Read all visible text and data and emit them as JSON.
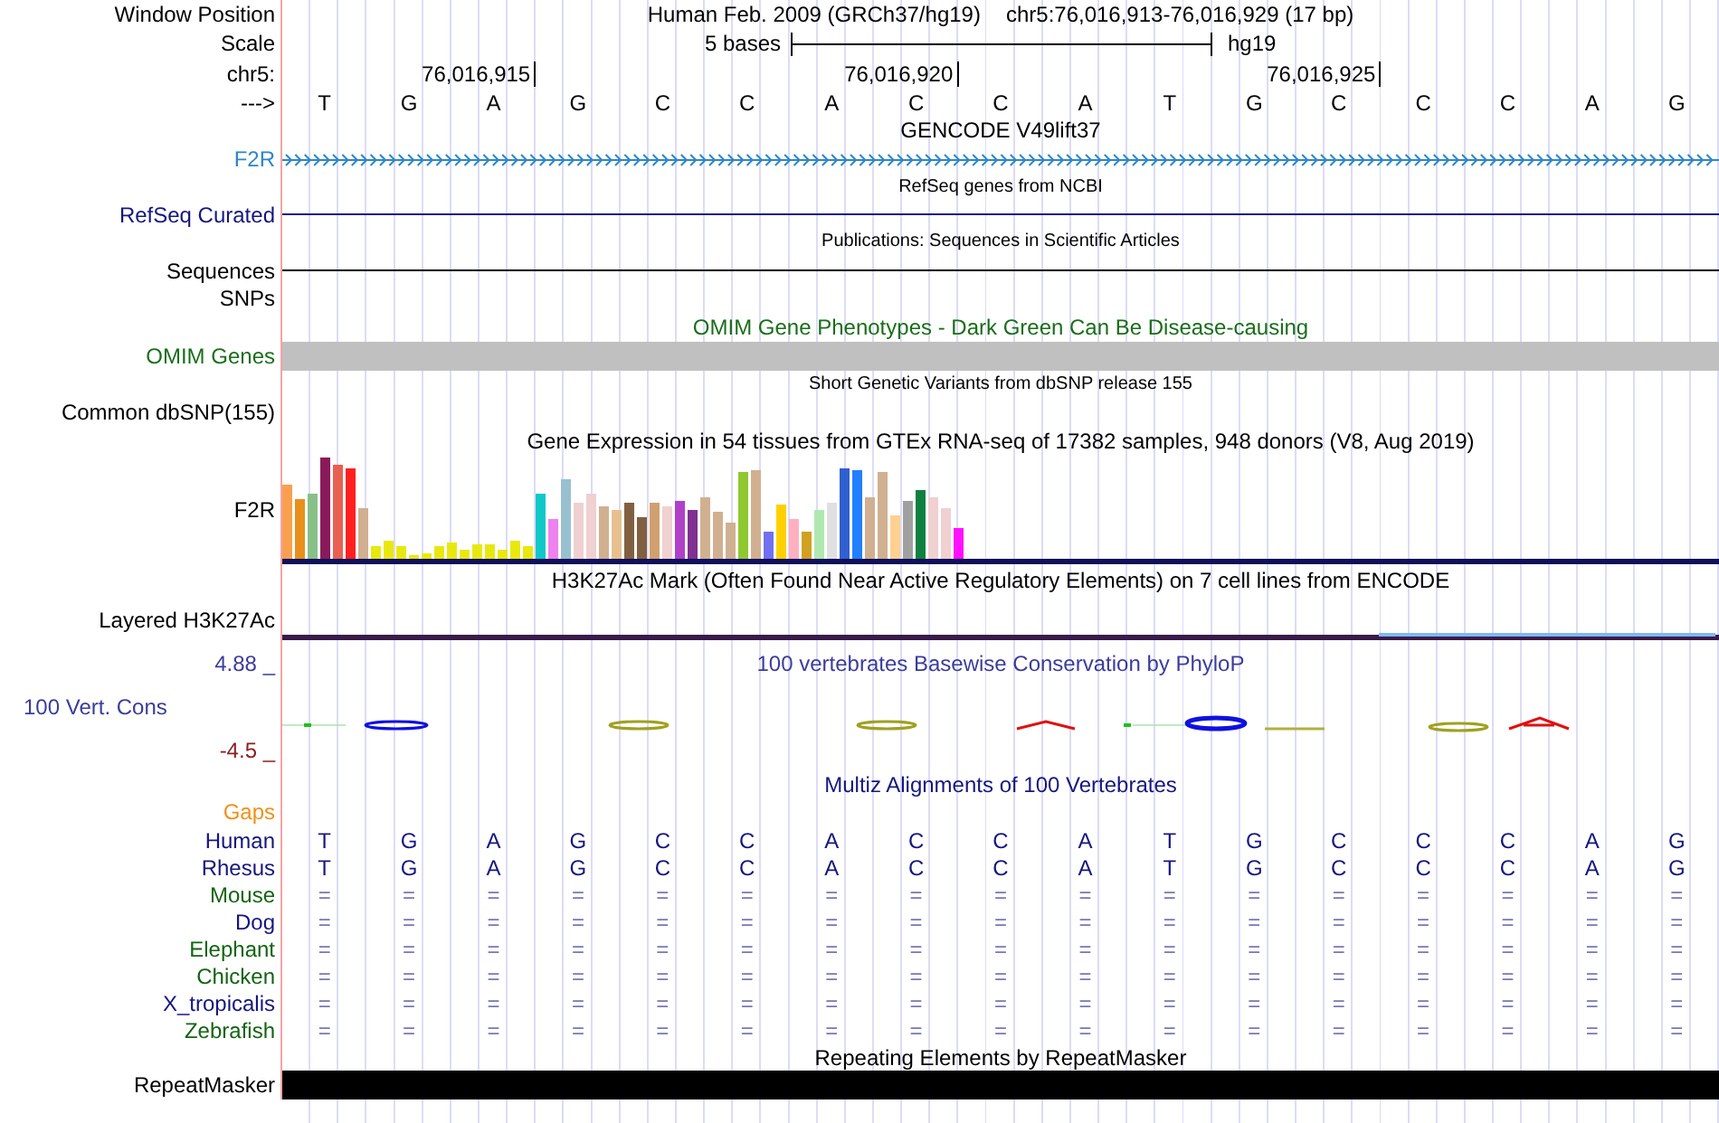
{
  "window_position": {
    "label": "Window Position",
    "assembly": "Human Feb. 2009 (GRCh37/hg19)",
    "region": "chr5:76,016,913-76,016,929 (17 bp)"
  },
  "scale": {
    "label": "Scale",
    "span": "5 bases",
    "assembly": "hg19"
  },
  "ruler": {
    "label": "chr5:",
    "ticks": [
      "76,016,915",
      "76,016,920",
      "76,016,925"
    ]
  },
  "sequence": {
    "label": "--->",
    "bases": [
      "T",
      "G",
      "A",
      "G",
      "C",
      "C",
      "A",
      "C",
      "C",
      "A",
      "T",
      "G",
      "C",
      "C",
      "C",
      "A",
      "G"
    ]
  },
  "tracks": [
    {
      "title": {
        "text": "GENCODE V49lift37",
        "kind": "heading",
        "color": "#000000"
      },
      "rows": [
        {
          "kind": "gene",
          "label": "F2R",
          "color": "#2e86c8"
        }
      ]
    },
    {
      "title": {
        "text": "RefSeq genes from NCBI",
        "kind": "note",
        "color": "#000000"
      },
      "rows": [
        {
          "kind": "line",
          "label": "RefSeq Curated",
          "color": "#16167e"
        }
      ]
    },
    {
      "title": {
        "text": "Publications: Sequences in Scientific Articles",
        "kind": "note",
        "color": "#000000"
      },
      "rows": [
        {
          "kind": "line",
          "label": "Sequences",
          "color": "#000000"
        },
        {
          "kind": "empty",
          "label": "SNPs",
          "color": "#000000"
        }
      ]
    },
    {
      "title": {
        "text": "OMIM Gene Phenotypes - Dark Green Can Be Disease-causing",
        "kind": "heading",
        "color": "#1a6e1a"
      },
      "rows": [
        {
          "kind": "phenotype",
          "label": "OMIM Genes",
          "color": "#1a6e1a"
        }
      ]
    },
    {
      "title": {
        "text": "Short Genetic Variants from dbSNP release 155",
        "kind": "note",
        "color": "#000000"
      },
      "rows": [
        {
          "kind": "empty",
          "label": "Common dbSNP(155)",
          "color": "#000000"
        }
      ]
    },
    {
      "title": {
        "text": "Gene Expression in 54 tissues from GTEx RNA-seq of 17382 samples, 948 donors (V8, Aug 2019)",
        "kind": "heading",
        "color": "#000000"
      },
      "rows": [
        {
          "kind": "expression",
          "label": "F2R",
          "color": "#000000"
        }
      ]
    },
    {
      "title": {
        "text": "H3K27Ac Mark (Often Found Near Active Regulatory Elements) on 7 cell lines from ENCODE",
        "kind": "heading",
        "color": "#000000"
      },
      "rows": [
        {
          "kind": "signal",
          "label": "Layered H3K27Ac",
          "color": "#000000"
        }
      ]
    },
    {
      "title": {
        "text": "100 vertebrates Basewise Conservation by PhyloP",
        "kind": "inline",
        "color": "#3c3c9c"
      },
      "rows": [
        {
          "kind": "conservation",
          "label": "100 Vert. Cons",
          "color": "#3c3c9c",
          "max": "4.88 _",
          "min": "-4.5 _"
        }
      ]
    },
    {
      "title": {
        "text": "Multiz Alignments of 100 Vertebrates",
        "kind": "heading",
        "color": "#16167e"
      },
      "rows": [
        {
          "kind": "empty",
          "label": "Gaps",
          "color": "#f09018"
        },
        {
          "kind": "sequence",
          "label": "Human",
          "color": "#16167e",
          "bases": [
            "T",
            "G",
            "A",
            "G",
            "C",
            "C",
            "A",
            "C",
            "C",
            "A",
            "T",
            "G",
            "C",
            "C",
            "C",
            "A",
            "G"
          ]
        },
        {
          "kind": "sequence",
          "label": "Rhesus",
          "color": "#16167e",
          "bases": [
            "T",
            "G",
            "A",
            "G",
            "C",
            "C",
            "A",
            "C",
            "C",
            "A",
            "T",
            "G",
            "C",
            "C",
            "C",
            "A",
            "G"
          ]
        },
        {
          "kind": "matches",
          "label": "Mouse",
          "color": "#136413",
          "bases": [
            "=",
            "=",
            "=",
            "=",
            "=",
            "=",
            "=",
            "=",
            "=",
            "=",
            "=",
            "=",
            "=",
            "=",
            "=",
            "=",
            "="
          ]
        },
        {
          "kind": "matches",
          "label": "Dog",
          "color": "#16167e",
          "bases": [
            "=",
            "=",
            "=",
            "=",
            "=",
            "=",
            "=",
            "=",
            "=",
            "=",
            "=",
            "=",
            "=",
            "=",
            "=",
            "=",
            "="
          ]
        },
        {
          "kind": "matches",
          "label": "Elephant",
          "color": "#136413",
          "bases": [
            "=",
            "=",
            "=",
            "=",
            "=",
            "=",
            "=",
            "=",
            "=",
            "=",
            "=",
            "=",
            "=",
            "=",
            "=",
            "=",
            "="
          ]
        },
        {
          "kind": "matches",
          "label": "Chicken",
          "color": "#136413",
          "bases": [
            "=",
            "=",
            "=",
            "=",
            "=",
            "=",
            "=",
            "=",
            "=",
            "=",
            "=",
            "=",
            "=",
            "=",
            "=",
            "=",
            "="
          ]
        },
        {
          "kind": "matches",
          "label": "X_tropicalis",
          "color": "#16167e",
          "bases": [
            "=",
            "=",
            "=",
            "=",
            "=",
            "=",
            "=",
            "=",
            "=",
            "=",
            "=",
            "=",
            "=",
            "=",
            "=",
            "=",
            "="
          ]
        },
        {
          "kind": "matches",
          "label": "Zebrafish",
          "color": "#136413",
          "bases": [
            "=",
            "=",
            "=",
            "=",
            "=",
            "=",
            "=",
            "=",
            "=",
            "=",
            "=",
            "=",
            "=",
            "=",
            "=",
            "=",
            "="
          ]
        }
      ]
    },
    {
      "title": {
        "text": "Repeating Elements by RepeatMasker",
        "kind": "heading",
        "color": "#000000"
      },
      "rows": [
        {
          "kind": "repeat",
          "label": "RepeatMasker",
          "color": "#000000"
        }
      ]
    }
  ]
}
